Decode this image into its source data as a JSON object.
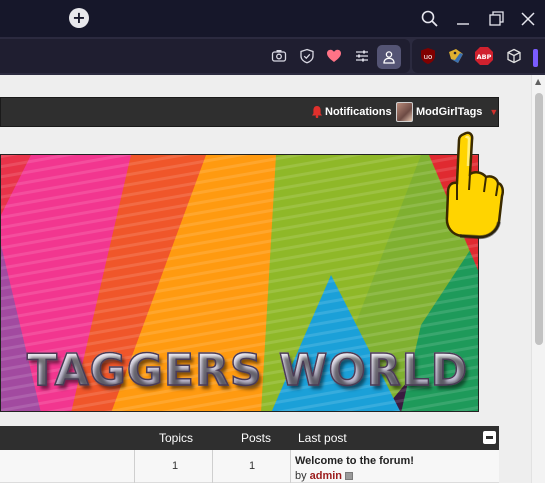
{
  "browser": {
    "new_tab_symbol": "+",
    "window_controls": [
      "search-icon",
      "minimize-icon",
      "restore-icon",
      "close-icon"
    ],
    "toolbar_icons": [
      "camera-icon",
      "shield-check-icon",
      "heart-icon",
      "sliders-icon",
      "profile-icon"
    ],
    "extensions": [
      {
        "name": "ublock-icon",
        "label": "uo",
        "color": "#800000"
      },
      {
        "name": "tag-extension-icon",
        "label": "",
        "color": "#e0b030"
      },
      {
        "name": "adblock-plus-icon",
        "label": "ABP",
        "color": "#d0212e"
      },
      {
        "name": "extensions-cube-icon",
        "label": "",
        "color": "#e0e0e0"
      }
    ],
    "accent_color": "#7a5cff"
  },
  "navbar": {
    "notifications_label": "Notifications",
    "username": "ModGirlTags",
    "username_color": "#ffffff",
    "caret_color": "#d0312d"
  },
  "banner": {
    "title": "TAGGERS WORLD"
  },
  "forum_table": {
    "headers": {
      "topics": "Topics",
      "posts": "Posts",
      "last_post": "Last post"
    },
    "rows": [
      {
        "topics": "1",
        "posts": "1",
        "last_post_title": "Welcome to the forum!",
        "by_label": "by",
        "author": "admin"
      }
    ]
  }
}
